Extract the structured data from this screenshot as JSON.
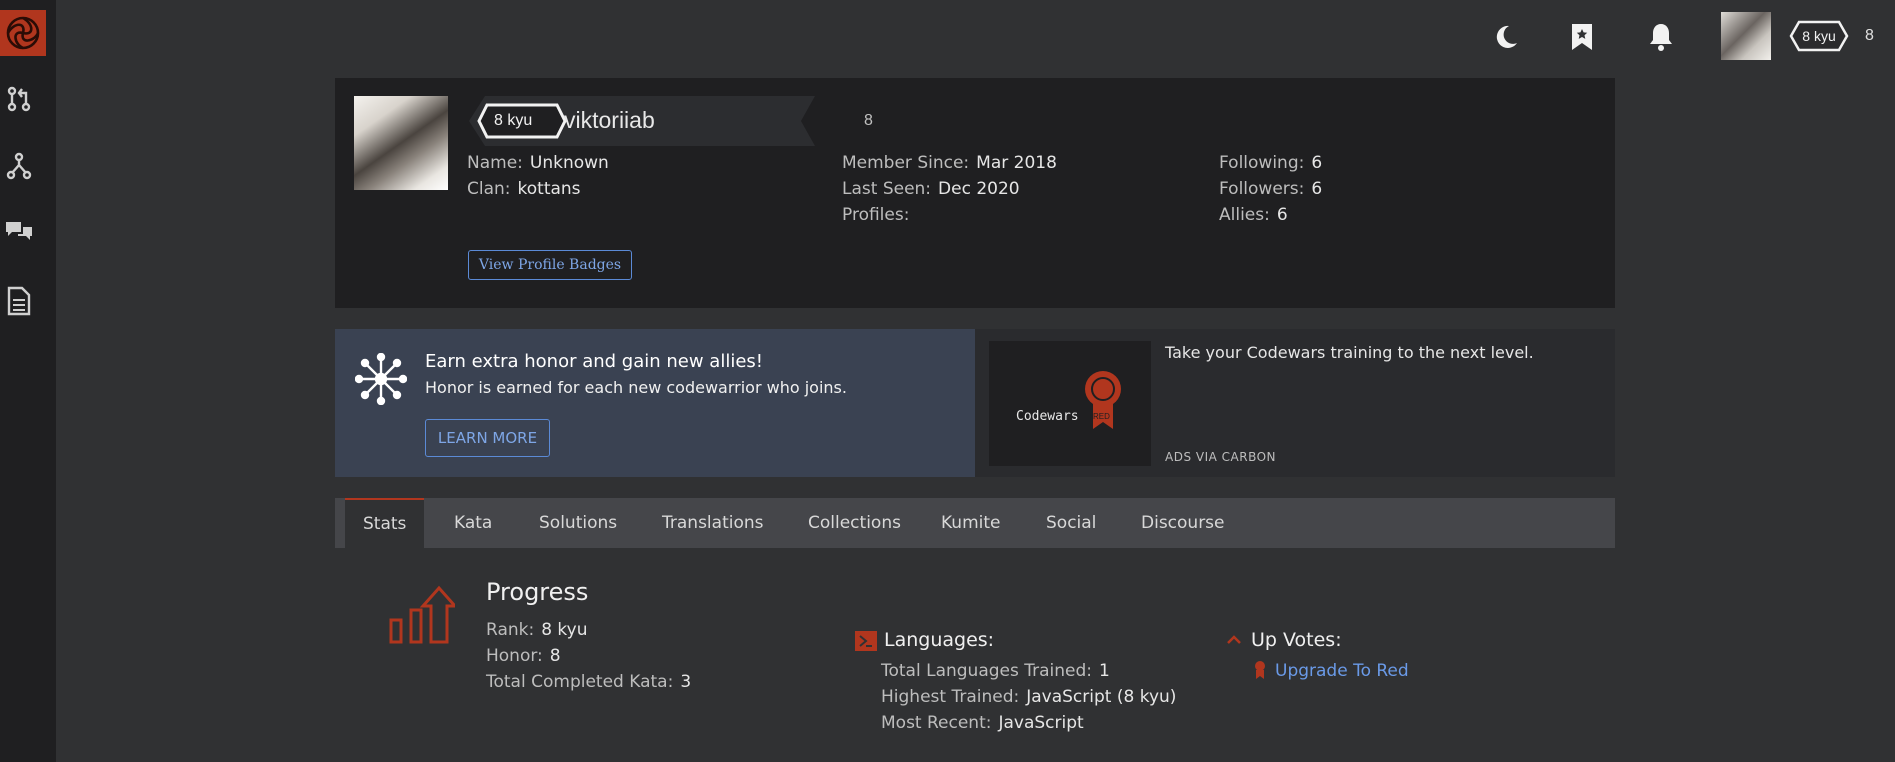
{
  "topbar": {
    "rank": "8 kyu",
    "honor": "8"
  },
  "profile": {
    "rank": "8 kyu",
    "username": "viktoriiab",
    "honor": "8",
    "name_label": "Name:",
    "name_value": "Unknown",
    "clan_label": "Clan:",
    "clan_value": "kottans",
    "member_since_label": "Member Since:",
    "member_since_value": "Mar 2018",
    "last_seen_label": "Last Seen:",
    "last_seen_value": "Dec 2020",
    "profiles_label": "Profiles:",
    "following_label": "Following:",
    "following_value": "6",
    "followers_label": "Followers:",
    "followers_value": "6",
    "allies_label": "Allies:",
    "allies_value": "6",
    "badges_button": "View Profile Badges"
  },
  "promo": {
    "title": "Earn extra honor and gain new allies!",
    "subtitle": "Honor is earned for each new codewarrior who joins.",
    "button": "LEARN MORE"
  },
  "ad": {
    "image_text": "Codewars",
    "image_badge": "RED",
    "text": "Take your Codewars training to the next level.",
    "via": "ADS VIA CARBON"
  },
  "tabs": [
    "Stats",
    "Kata",
    "Solutions",
    "Translations",
    "Collections",
    "Kumite",
    "Social",
    "Discourse"
  ],
  "progress": {
    "title": "Progress",
    "rank_label": "Rank:",
    "rank_value": "8 kyu",
    "honor_label": "Honor:",
    "honor_value": "8",
    "completed_label": "Total Completed Kata:",
    "completed_value": "3"
  },
  "languages": {
    "title": "Languages:",
    "total_label": "Total Languages Trained:",
    "total_value": "1",
    "highest_label": "Highest Trained:",
    "highest_value": "JavaScript (8 kyu)",
    "recent_label": "Most Recent:",
    "recent_value": "JavaScript"
  },
  "upvotes": {
    "title": "Up Votes:",
    "link": "Upgrade To Red"
  },
  "colors": {
    "accent_red": "#b1361e",
    "link_blue": "#6a9ae8"
  }
}
